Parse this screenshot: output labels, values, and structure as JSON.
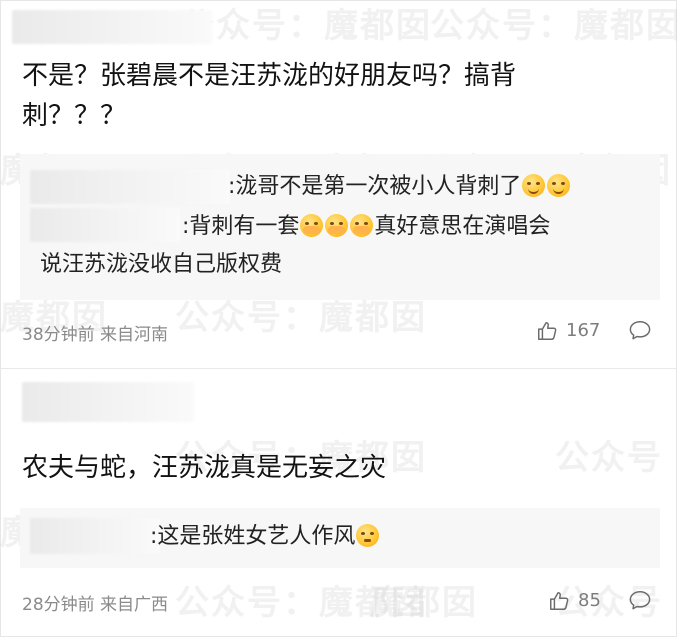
{
  "watermarks": [
    "公众号：魔都囡",
    "公众号：魔都囡",
    "魔都囡",
    "公众号：魔都囡",
    "公众号：魔都囡",
    "魔都囡",
    "公众号：魔都囡",
    "公众号",
    "公众号：魔都囡",
    "魔都囡",
    "公众号：魔都囡",
    "公众号",
    "魔都囡"
  ],
  "comments": [
    {
      "text_line1": "不是？张碧晨不是汪苏泷的好朋友吗？搞背",
      "text_line2": "刺？？？",
      "replies": [
        {
          "text": ":泷哥不是第一次被小人背刺了",
          "emojis": [
            "smile-emoji",
            "smile-emoji"
          ]
        },
        {
          "text_before": ":背刺有一套",
          "emojis": [
            "cover-face-emoji",
            "cover-face-emoji",
            "cover-face-emoji"
          ],
          "text_after": "真好意思在演唱会",
          "text_line2": "说汪苏泷没收自己版权费"
        }
      ],
      "time": "38分钟前",
      "source": "来自河南",
      "likes": "167"
    },
    {
      "text_line1": "农夫与蛇，汪苏泷真是无妄之灾",
      "replies": [
        {
          "text": ":这是张姓女艺人作风",
          "emojis": [
            "eye-roll-emoji"
          ]
        }
      ],
      "time": "28分钟前",
      "source": "来自广西",
      "likes": "85"
    }
  ],
  "icons": {
    "like": "thumbs-up-icon",
    "comment": "comment-bubble-icon"
  }
}
